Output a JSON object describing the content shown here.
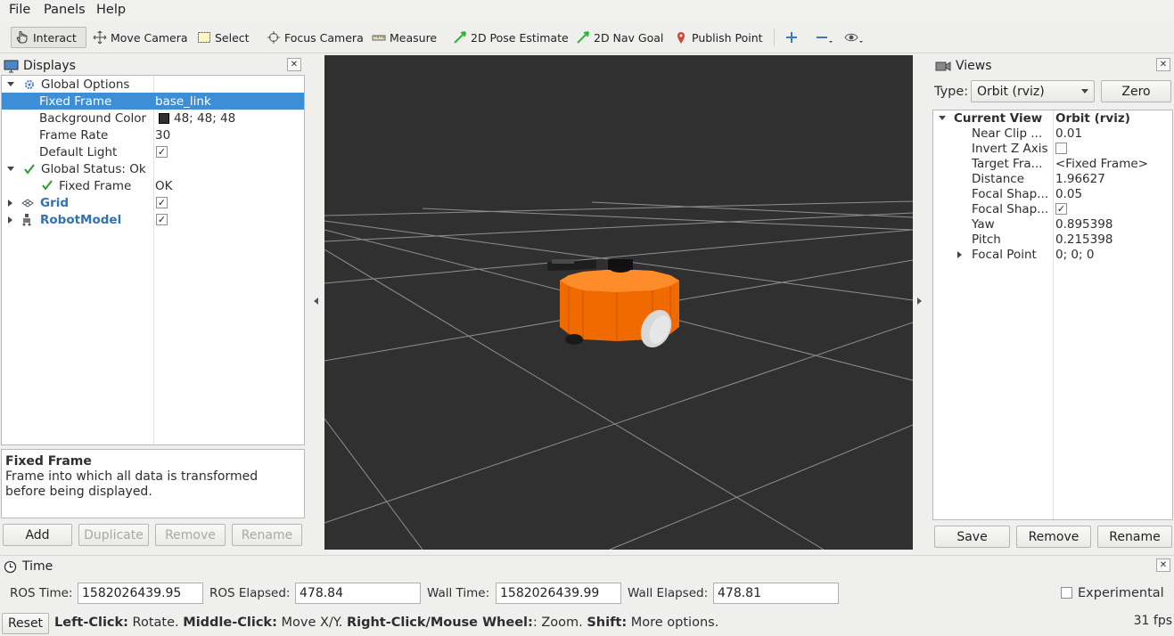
{
  "menu": {
    "file": "File",
    "panels": "Panels",
    "help": "Help"
  },
  "toolbar": {
    "interact": "Interact",
    "move_camera": "Move Camera",
    "select": "Select",
    "focus_camera": "Focus Camera",
    "measure": "Measure",
    "pose_estimate": "2D Pose Estimate",
    "nav_goal": "2D Nav Goal",
    "publish_point": "Publish Point"
  },
  "displays": {
    "title": "Displays",
    "global_options": "Global Options",
    "fixed_frame_label": "Fixed Frame",
    "fixed_frame_value": "base_link",
    "background_color_label": "Background Color",
    "background_color_value": "48; 48; 48",
    "frame_rate_label": "Frame Rate",
    "frame_rate_value": "30",
    "default_light_label": "Default Light",
    "default_light_checked": "✓",
    "global_status": "Global Status: Ok",
    "status_fixed_frame_label": "Fixed Frame",
    "status_fixed_frame_value": "OK",
    "grid": "Grid",
    "grid_checked": "✓",
    "robot_model": "RobotModel",
    "robot_model_checked": "✓",
    "desc_title": "Fixed Frame",
    "desc_text": "Frame into which all data is transformed before being displayed.",
    "buttons": {
      "add": "Add",
      "duplicate": "Duplicate",
      "remove": "Remove",
      "rename": "Rename"
    }
  },
  "views": {
    "title": "Views",
    "type_label": "Type:",
    "type_value": "Orbit (rviz)",
    "zero": "Zero",
    "current_view_label": "Current View",
    "current_view_value": "Orbit (rviz)",
    "rows": [
      {
        "label": "Near Clip ...",
        "value": "0.01"
      },
      {
        "label": "Invert Z Axis",
        "value": ""
      },
      {
        "label": "Target Fra...",
        "value": "<Fixed Frame>"
      },
      {
        "label": "Distance",
        "value": "1.96627"
      },
      {
        "label": "Focal Shap...",
        "value": "0.05"
      },
      {
        "label": "Focal Shap...",
        "value": "✓"
      },
      {
        "label": "Yaw",
        "value": "0.895398"
      },
      {
        "label": "Pitch",
        "value": "0.215398"
      },
      {
        "label": "Focal Point",
        "value": "0; 0; 0"
      }
    ],
    "buttons": {
      "save": "Save",
      "remove": "Remove",
      "rename": "Rename"
    }
  },
  "time": {
    "title": "Time",
    "ros_time_label": "ROS Time:",
    "ros_time": "1582026439.95",
    "ros_elapsed_label": "ROS Elapsed:",
    "ros_elapsed": "478.84",
    "wall_time_label": "Wall Time:",
    "wall_time": "1582026439.99",
    "wall_elapsed_label": "Wall Elapsed:",
    "wall_elapsed": "478.81",
    "experimental": "Experimental"
  },
  "status": {
    "reset": "Reset",
    "left_click": "Left-Click:",
    "left_click_desc": " Rotate.",
    "middle_click": "Middle-Click:",
    "middle_click_desc": " Move X/Y.",
    "right_click": "Right-Click/Mouse Wheel:",
    "right_click_desc": ": Zoom.",
    "shift": "Shift:",
    "shift_desc": " More options.",
    "fps": "31 fps"
  },
  "colors": {
    "background": "#303030",
    "selection": "#3c8ed6",
    "robot": "#f06a00"
  }
}
